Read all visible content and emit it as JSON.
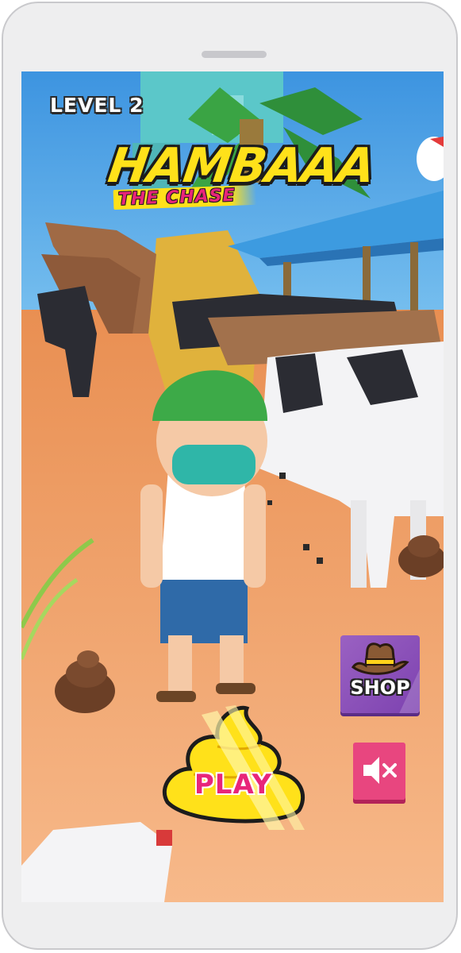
{
  "hud": {
    "level_label": "LEVEL 2"
  },
  "title": {
    "main": "HAMBAAA",
    "sub": "THE CHASE"
  },
  "buttons": {
    "play_label": "PLAY",
    "shop_label": "SHOP",
    "shop_icon": "cowboy-hat-icon",
    "sound_icon": "speaker-muted-icon"
  },
  "colors": {
    "title_yellow": "#ffe11a",
    "accent_pink": "#e8257a",
    "shop_purple": "#8a4fbc",
    "mute_pink": "#e8467f",
    "sand": "#f2b583",
    "sky": "#4aa3e8"
  }
}
